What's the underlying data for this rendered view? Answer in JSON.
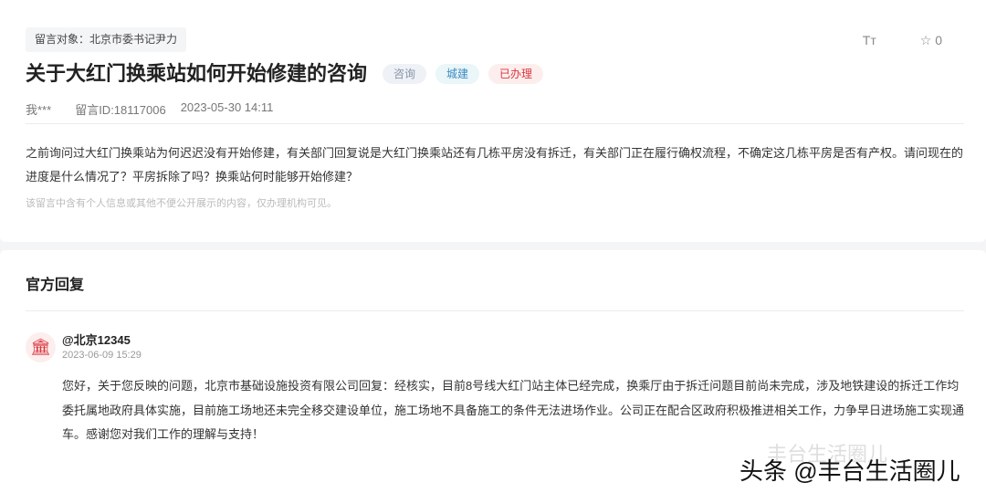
{
  "message": {
    "target": "留言对象：北京市委书记尹力",
    "title": "关于大红门换乘站如何开始修建的咨询",
    "tags": [
      "咨询",
      "城建",
      "已办理"
    ],
    "font_toggle": "Tт",
    "favorites": "0",
    "author": "我***",
    "id": "留言ID:18117006",
    "datetime": "2023-05-30 14:11",
    "body": "之前询问过大红门换乘站为何迟迟没有开始修建，有关部门回复说是大红门换乘站还有几栋平房没有拆迁，有关部门正在履行确权流程，不确定这几栋平房是否有产权。请问现在的进度是什么情况了？平房拆除了吗？换乘站何时能够开始修建？",
    "privacy_note": "该留言中含有个人信息或其他不便公开展示的内容，仅办理机构可见。"
  },
  "reply": {
    "section_title": "官方回复",
    "name": "@北京12345",
    "datetime": "2023-06-09 15:29",
    "text": "您好，关于您反映的问题，北京市基础设施投资有限公司回复：经核实，目前8号线大红门站主体已经完成，换乘厅由于拆迁问题目前尚未完成，涉及地铁建设的拆迁工作均委托属地政府具体实施，目前施工场地还未完全移交建设单位，施工场地不具备施工的条件无法进场作业。公司正在配合区政府积极推进相关工作，力争早日进场施工实现通车。感谢您对我们工作的理解与支持！"
  },
  "watermark": {
    "faint": "丰台生活圈儿",
    "main": "头条 @丰台生活圈儿"
  }
}
